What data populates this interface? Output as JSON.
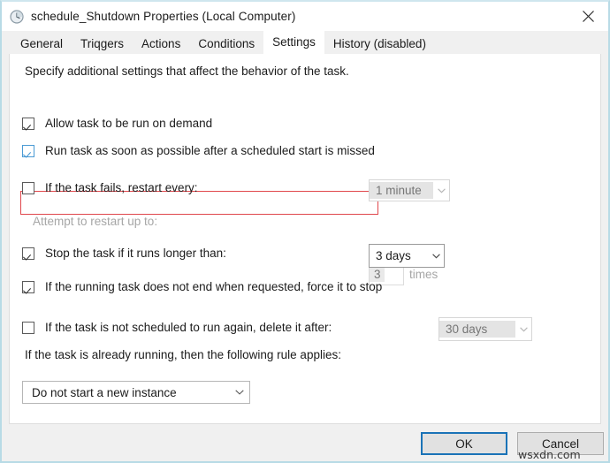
{
  "window": {
    "title": "schedule_Shutdown Properties (Local Computer)",
    "icon": "clock-icon",
    "close_icon": "close-icon",
    "accent_focus_color": "#1a73b7",
    "highlight_color": "#e0474c"
  },
  "tabs": [
    {
      "label": "General",
      "active": false
    },
    {
      "label": "Triqgers",
      "active": false
    },
    {
      "label": "Actions",
      "active": false
    },
    {
      "label": "Conditions",
      "active": false
    },
    {
      "label": "Settings",
      "active": true
    },
    {
      "label": "History (disabled)",
      "active": false
    }
  ],
  "main": {
    "intro": "Specify additional settings that affect the behavior of the task.",
    "checkboxes": [
      {
        "label": "Allow task to be run on demand",
        "checked": true,
        "focused": false,
        "enabled": true
      },
      {
        "label": "Run task as soon as possible after a scheduled start is missed",
        "checked": true,
        "focused": true,
        "enabled": true,
        "highlighted": true
      },
      {
        "label": "If the task fails, restart every:",
        "checked": false,
        "focused": false,
        "enabled": true
      },
      {
        "label": "Stop the task if it runs longer than:",
        "checked": true,
        "focused": false,
        "enabled": true
      },
      {
        "label": "If the running task does not end when requested, force it to stop",
        "checked": true,
        "focused": false,
        "enabled": true
      },
      {
        "label": "If the task is not scheduled to run again, delete it after:",
        "checked": false,
        "focused": false,
        "enabled": true
      }
    ],
    "restart_interval": {
      "value": "1 minute",
      "enabled": false
    },
    "attempt_label": "Attempt to restart up to:",
    "attempt_count": "3",
    "times_label": "times",
    "stop_after": {
      "value": "3 days",
      "enabled": true
    },
    "delete_after": {
      "value": "30 days",
      "enabled": false
    },
    "rule_text": "If the task is already running, then the following rule applies:",
    "rule_value": "Do not start a new instance"
  },
  "footer": {
    "ok_label": "OK",
    "cancel_label": "Cancel"
  },
  "watermark": "wsxdn.com"
}
